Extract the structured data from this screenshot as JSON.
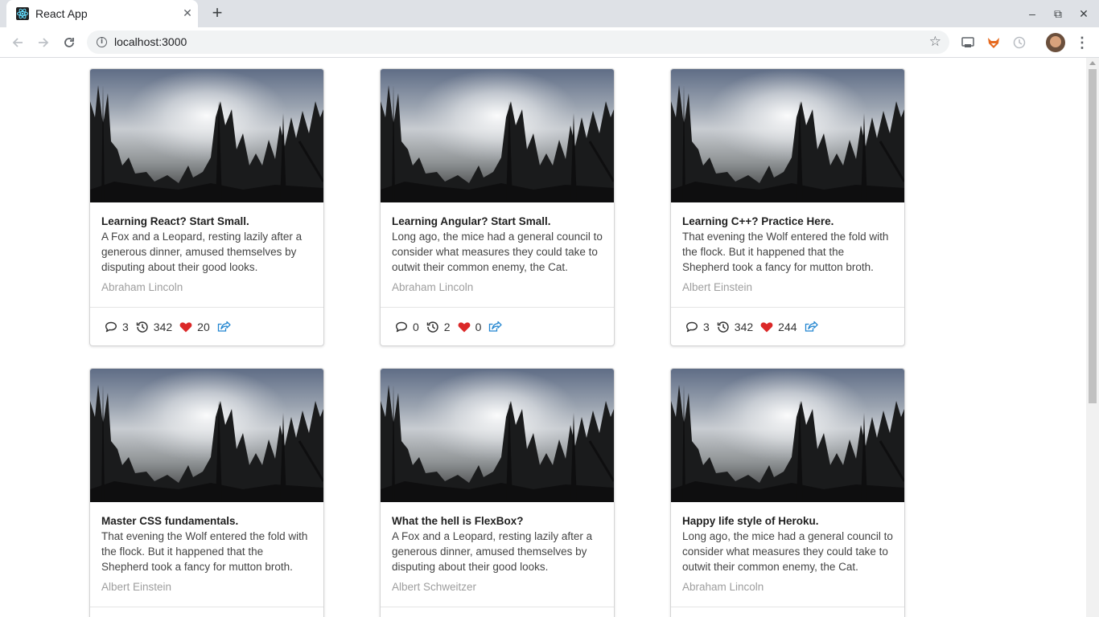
{
  "browser": {
    "tab_title": "React App",
    "tab_close": "✕",
    "new_tab": "+",
    "url": "localhost:3000",
    "window_controls": {
      "minimize": "–",
      "restore": "⧉",
      "close": "✕"
    },
    "icons": [
      "react-favicon",
      "back-icon",
      "forward-icon",
      "reload-icon",
      "info-icon",
      "star-icon",
      "cast-icon",
      "fox-extension-icon",
      "clock-extension-icon",
      "avatar",
      "menu-icon"
    ]
  },
  "colors": {
    "heart": "#db2828",
    "share": "#2185d0",
    "card_border": "#d4d4d5"
  },
  "cards": [
    {
      "title": "Learning React? Start Small.",
      "description": "A Fox and a Leopard, resting lazily after a generous dinner, amused themselves by disputing about their good looks.",
      "author": "Abraham Lincoln",
      "comments": "3",
      "views": "342",
      "likes": "20"
    },
    {
      "title": "Learning Angular? Start Small.",
      "description": "Long ago, the mice had a general council to consider what measures they could take to outwit their common enemy, the Cat.",
      "author": "Abraham Lincoln",
      "comments": "0",
      "views": "2",
      "likes": "0"
    },
    {
      "title": "Learning C++? Practice Here.",
      "description": "That evening the Wolf entered the fold with the flock. But it happened that the Shepherd took a fancy for mutton broth.",
      "author": "Albert Einstein",
      "comments": "3",
      "views": "342",
      "likes": "244"
    },
    {
      "title": "Master CSS fundamentals.",
      "description": "That evening the Wolf entered the fold with the flock. But it happened that the Shepherd took a fancy for mutton broth.",
      "author": "Albert Einstein",
      "comments": "",
      "views": "",
      "likes": ""
    },
    {
      "title": "What the hell is FlexBox?",
      "description": "A Fox and a Leopard, resting lazily after a generous dinner, amused themselves by disputing about their good looks.",
      "author": "Albert Schweitzer",
      "comments": "",
      "views": "",
      "likes": ""
    },
    {
      "title": "Happy life style of Heroku.",
      "description": "Long ago, the mice had a general council to consider what measures they could take to outwit their common enemy, the Cat.",
      "author": "Abraham Lincoln",
      "comments": "",
      "views": "",
      "likes": ""
    }
  ]
}
